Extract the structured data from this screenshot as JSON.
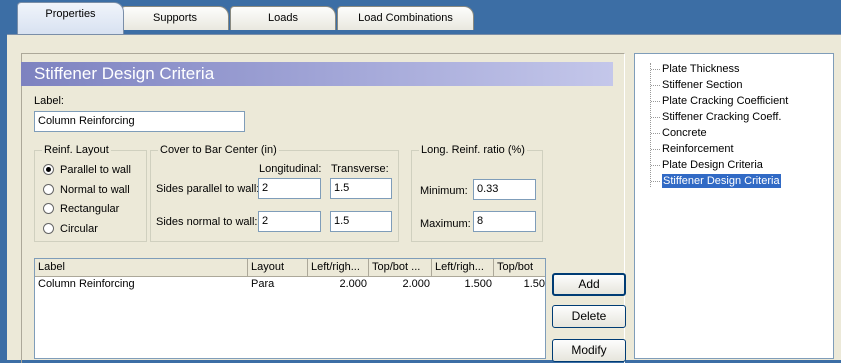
{
  "tabs": [
    {
      "label": "Properties",
      "active": true
    },
    {
      "label": "Supports",
      "active": false
    },
    {
      "label": "Loads",
      "active": false
    },
    {
      "label": "Load Combinations",
      "active": false
    }
  ],
  "panel": {
    "title": "Stiffener Design Criteria",
    "label_caption": "Label:",
    "label_value": "Column Reinforcing"
  },
  "reinf_layout": {
    "title": "Reinf. Layout",
    "options": [
      "Parallel to wall",
      "Normal to wall",
      "Rectangular",
      "Circular"
    ],
    "selected": "Parallel to wall"
  },
  "cover": {
    "title": "Cover to Bar Center (in)",
    "col_longitudinal": "Longitudinal:",
    "col_transverse": "Transverse:",
    "row_parallel": "Sides parallel to wall:",
    "row_normal": "Sides normal to wall:",
    "parallel_long": "2",
    "parallel_trans": "1.5",
    "normal_long": "2",
    "normal_trans": "1.5"
  },
  "ratio": {
    "title": "Long. Reinf. ratio (%)",
    "min_label": "Minimum:",
    "min_value": "0.33",
    "max_label": "Maximum:",
    "max_value": "8"
  },
  "table": {
    "headers": [
      "Label",
      "Layout",
      "Left/righ...",
      "Top/bot ...",
      "Left/righ...",
      "Top/bot"
    ],
    "rows": [
      [
        "Column Reinforcing",
        "Para",
        "2.000",
        "2.000",
        "1.500",
        "1.50"
      ]
    ]
  },
  "buttons": {
    "add": "Add",
    "delete": "Delete",
    "modify": "Modify"
  },
  "tree": {
    "items": [
      "Plate Thickness",
      "Stiffener Section",
      "Plate Cracking Coefficient",
      "Stiffener Cracking Coeff.",
      "Concrete",
      "Reinforcement",
      "Plate Design Criteria",
      "Stiffener Design Criteria"
    ],
    "selected": "Stiffener Design Criteria"
  }
}
